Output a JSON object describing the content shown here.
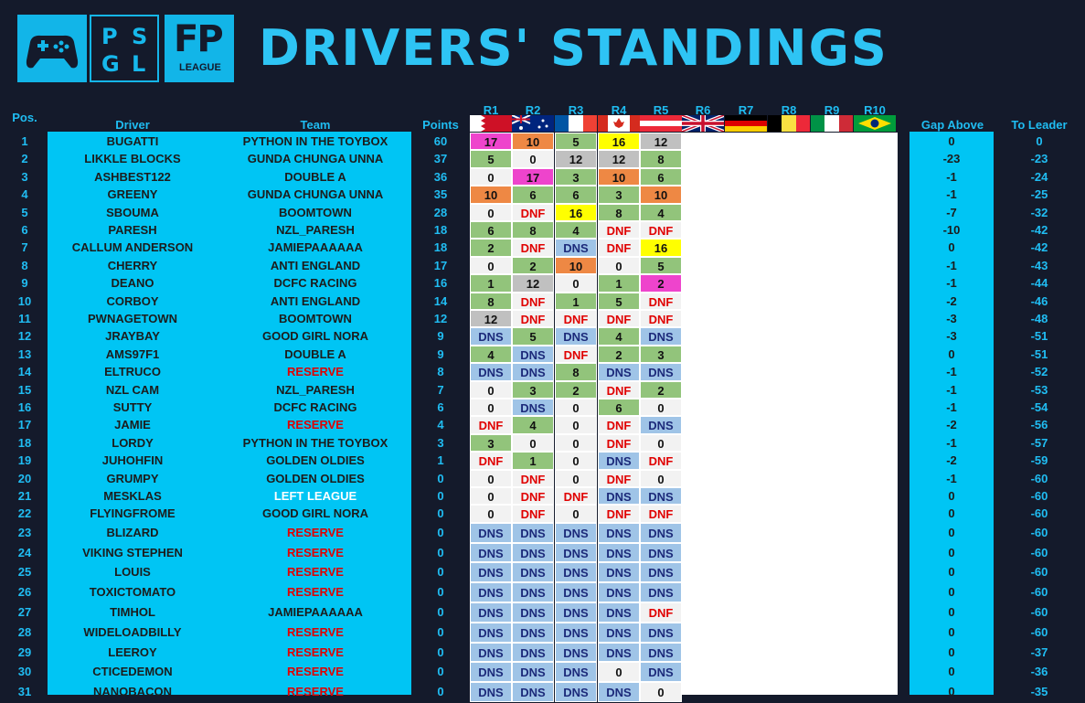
{
  "title": "DRIVERS' STANDINGS",
  "logos": {
    "psgl": [
      "P",
      "S",
      "G",
      "L"
    ],
    "fp": "FP",
    "fp_sub": "LEAGUE"
  },
  "headers": {
    "pos": "Pos.",
    "driver": "Driver",
    "team": "Team",
    "points": "Points",
    "gap": "Gap Above",
    "leader": "To Leader",
    "rounds": [
      "R1",
      "R2",
      "R3",
      "R4",
      "R5",
      "R6",
      "R7",
      "R8",
      "R9",
      "R10"
    ]
  },
  "flags": [
    "bahrain-flag",
    "australia-flag",
    "france-flag",
    "canada-flag",
    "austria-flag",
    "uk-flag",
    "germany-flag",
    "belgium-flag",
    "italy-flag",
    "brazil-flag"
  ],
  "colors": {
    "bg": "#141a2b",
    "accent": "#00c5f4",
    "pink": "#ee44cc",
    "orange": "#ee8844",
    "yellow": "#ffff00",
    "silver": "#c0c0c0",
    "green": "#92c47b",
    "dns": "#9fc4e7",
    "light": "#f2f2f2",
    "dnf_text": "#e00000",
    "dns_text": "#1c2a7a",
    "reserve_text": "#e00000",
    "left_text": "#ffffff"
  },
  "rows": [
    {
      "pos": "1",
      "driver": "BUGATTI",
      "team": "PYTHON IN THE TOYBOX",
      "team_style": "n",
      "points": "60",
      "r": [
        "17",
        "10",
        "5",
        "16",
        "12"
      ],
      "c": [
        "pink",
        "orange",
        "green",
        "yellow",
        "silver"
      ],
      "gap": "0",
      "leader": "0"
    },
    {
      "pos": "2",
      "driver": "LIKKLE BLOCKS",
      "team": "GUNDA CHUNGA UNNA",
      "team_style": "n",
      "points": "37",
      "r": [
        "5",
        "0",
        "12",
        "12",
        "8"
      ],
      "c": [
        "green",
        "light",
        "silver",
        "silver",
        "green"
      ],
      "gap": "-23",
      "leader": "-23"
    },
    {
      "pos": "3",
      "driver": "ASHBEST122",
      "team": "DOUBLE A",
      "team_style": "n",
      "points": "36",
      "r": [
        "0",
        "17",
        "3",
        "10",
        "6"
      ],
      "c": [
        "light",
        "pink",
        "green",
        "orange",
        "green"
      ],
      "gap": "-1",
      "leader": "-24"
    },
    {
      "pos": "4",
      "driver": "GREENY",
      "team": "GUNDA CHUNGA UNNA",
      "team_style": "n",
      "points": "35",
      "r": [
        "10",
        "6",
        "6",
        "3",
        "10"
      ],
      "c": [
        "orange",
        "green",
        "green",
        "green",
        "orange"
      ],
      "gap": "-1",
      "leader": "-25"
    },
    {
      "pos": "5",
      "driver": "SBOUMA",
      "team": "BOOMTOWN",
      "team_style": "n",
      "points": "28",
      "r": [
        "0",
        "DNF",
        "16",
        "8",
        "4"
      ],
      "c": [
        "light",
        "light",
        "yellow",
        "green",
        "green"
      ],
      "gap": "-7",
      "leader": "-32"
    },
    {
      "pos": "6",
      "driver": "PARESH",
      "team": "NZL_PARESH",
      "team_style": "n",
      "points": "18",
      "r": [
        "6",
        "8",
        "4",
        "DNF",
        "DNF"
      ],
      "c": [
        "green",
        "green",
        "green",
        "light",
        "light"
      ],
      "gap": "-10",
      "leader": "-42"
    },
    {
      "pos": "7",
      "driver": "CALLUM ANDERSON",
      "team": "JAMIEPAAAAAA",
      "team_style": "n",
      "points": "18",
      "r": [
        "2",
        "DNF",
        "DNS",
        "DNF",
        "16"
      ],
      "c": [
        "green",
        "light",
        "dns",
        "light",
        "yellow"
      ],
      "gap": "0",
      "leader": "-42"
    },
    {
      "pos": "8",
      "driver": "CHERRY",
      "team": "ANTI ENGLAND",
      "team_style": "n",
      "points": "17",
      "r": [
        "0",
        "2",
        "10",
        "0",
        "5"
      ],
      "c": [
        "light",
        "green",
        "orange",
        "light",
        "green"
      ],
      "gap": "-1",
      "leader": "-43"
    },
    {
      "pos": "9",
      "driver": "DEANO",
      "team": "DCFC RACING",
      "team_style": "n",
      "points": "16",
      "r": [
        "1",
        "12",
        "0",
        "1",
        "2"
      ],
      "c": [
        "green",
        "silver",
        "light",
        "green",
        "pink"
      ],
      "gap": "-1",
      "leader": "-44"
    },
    {
      "pos": "10",
      "driver": "CORBOY",
      "team": "ANTI ENGLAND",
      "team_style": "n",
      "points": "14",
      "r": [
        "8",
        "DNF",
        "1",
        "5",
        "DNF"
      ],
      "c": [
        "green",
        "light",
        "green",
        "green",
        "light"
      ],
      "gap": "-2",
      "leader": "-46"
    },
    {
      "pos": "11",
      "driver": "PWNAGETOWN",
      "team": "BOOMTOWN",
      "team_style": "n",
      "points": "12",
      "r": [
        "12",
        "DNF",
        "DNF",
        "DNF",
        "DNF"
      ],
      "c": [
        "silver",
        "light",
        "light",
        "light",
        "light"
      ],
      "gap": "-3",
      "leader": "-48"
    },
    {
      "pos": "12",
      "driver": "JRAYBAY",
      "team": "GOOD GIRL NORA",
      "team_style": "n",
      "points": "9",
      "r": [
        "DNS",
        "5",
        "DNS",
        "4",
        "DNS"
      ],
      "c": [
        "dns",
        "green",
        "dns",
        "green",
        "dns"
      ],
      "gap": "-3",
      "leader": "-51"
    },
    {
      "pos": "13",
      "driver": "AMS97F1",
      "team": "DOUBLE A",
      "team_style": "n",
      "points": "9",
      "r": [
        "4",
        "DNS",
        "DNF",
        "2",
        "3"
      ],
      "c": [
        "green",
        "dns",
        "light",
        "green",
        "green"
      ],
      "gap": "0",
      "leader": "-51"
    },
    {
      "pos": "14",
      "driver": "ELTRUCO",
      "team": "RESERVE",
      "team_style": "r",
      "points": "8",
      "r": [
        "DNS",
        "DNS",
        "8",
        "DNS",
        "DNS"
      ],
      "c": [
        "dns",
        "dns",
        "green",
        "dns",
        "dns"
      ],
      "gap": "-1",
      "leader": "-52"
    },
    {
      "pos": "15",
      "driver": "NZL CAM",
      "team": "NZL_PARESH",
      "team_style": "n",
      "points": "7",
      "r": [
        "0",
        "3",
        "2",
        "DNF",
        "2"
      ],
      "c": [
        "light",
        "green",
        "green",
        "light",
        "green"
      ],
      "gap": "-1",
      "leader": "-53"
    },
    {
      "pos": "16",
      "driver": "SUTTY",
      "team": "DCFC RACING",
      "team_style": "n",
      "points": "6",
      "r": [
        "0",
        "DNS",
        "0",
        "6",
        "0"
      ],
      "c": [
        "light",
        "dns",
        "light",
        "green",
        "light"
      ],
      "gap": "-1",
      "leader": "-54"
    },
    {
      "pos": "17",
      "driver": "JAMIE",
      "team": "RESERVE",
      "team_style": "r",
      "points": "4",
      "r": [
        "DNF",
        "4",
        "0",
        "DNF",
        "DNS"
      ],
      "c": [
        "light",
        "green",
        "light",
        "light",
        "dns"
      ],
      "gap": "-2",
      "leader": "-56"
    },
    {
      "pos": "18",
      "driver": "LORDY",
      "team": "PYTHON IN THE TOYBOX",
      "team_style": "n",
      "points": "3",
      "r": [
        "3",
        "0",
        "0",
        "DNF",
        "0"
      ],
      "c": [
        "green",
        "light",
        "light",
        "light",
        "light"
      ],
      "gap": "-1",
      "leader": "-57"
    },
    {
      "pos": "19",
      "driver": "JUHOHFIN",
      "team": "GOLDEN OLDIES",
      "team_style": "n",
      "points": "1",
      "r": [
        "DNF",
        "1",
        "0",
        "DNS",
        "DNF"
      ],
      "c": [
        "light",
        "green",
        "light",
        "dns",
        "light"
      ],
      "gap": "-2",
      "leader": "-59"
    },
    {
      "pos": "20",
      "driver": "GRUMPY",
      "team": "GOLDEN OLDIES",
      "team_style": "n",
      "points": "0",
      "r": [
        "0",
        "DNF",
        "0",
        "DNF",
        "0"
      ],
      "c": [
        "light",
        "light",
        "light",
        "light",
        "light"
      ],
      "gap": "-1",
      "leader": "-60"
    },
    {
      "pos": "21",
      "driver": "MESKLAS",
      "team": "LEFT LEAGUE",
      "team_style": "w",
      "points": "0",
      "r": [
        "0",
        "DNF",
        "DNF",
        "DNS",
        "DNS"
      ],
      "c": [
        "light",
        "light",
        "light",
        "dns",
        "dns"
      ],
      "gap": "0",
      "leader": "-60"
    },
    {
      "pos": "22",
      "driver": "FLYINGFROME",
      "team": "GOOD GIRL NORA",
      "team_style": "n",
      "points": "0",
      "r": [
        "0",
        "DNF",
        "0",
        "DNF",
        "DNF"
      ],
      "c": [
        "light",
        "light",
        "light",
        "light",
        "light"
      ],
      "gap": "0",
      "leader": "-60"
    },
    {
      "pos": "23",
      "driver": "BLIZARD",
      "team": "RESERVE",
      "team_style": "r",
      "points": "0",
      "r": [
        "DNS",
        "DNS",
        "DNS",
        "DNS",
        "DNS"
      ],
      "c": [
        "dns",
        "dns",
        "dns",
        "dns",
        "dns"
      ],
      "gap": "0",
      "leader": "-60"
    },
    {
      "pos": "24",
      "driver": "VIKING STEPHEN",
      "team": "RESERVE",
      "team_style": "r",
      "points": "0",
      "r": [
        "DNS",
        "DNS",
        "DNS",
        "DNS",
        "DNS"
      ],
      "c": [
        "dns",
        "dns",
        "dns",
        "dns",
        "dns"
      ],
      "gap": "0",
      "leader": "-60"
    },
    {
      "pos": "25",
      "driver": "LOUIS",
      "team": "RESERVE",
      "team_style": "r",
      "points": "0",
      "r": [
        "DNS",
        "DNS",
        "DNS",
        "DNS",
        "DNS"
      ],
      "c": [
        "dns",
        "dns",
        "dns",
        "dns",
        "dns"
      ],
      "gap": "0",
      "leader": "-60"
    },
    {
      "pos": "26",
      "driver": "TOXICTOMATO",
      "team": "RESERVE",
      "team_style": "r",
      "points": "0",
      "r": [
        "DNS",
        "DNS",
        "DNS",
        "DNS",
        "DNS"
      ],
      "c": [
        "dns",
        "dns",
        "dns",
        "dns",
        "dns"
      ],
      "gap": "0",
      "leader": "-60"
    },
    {
      "pos": "27",
      "driver": "TIMHOL",
      "team": "JAMIEPAAAAAA",
      "team_style": "n",
      "points": "0",
      "r": [
        "DNS",
        "DNS",
        "DNS",
        "DNS",
        "DNF"
      ],
      "c": [
        "dns",
        "dns",
        "dns",
        "dns",
        "light"
      ],
      "gap": "0",
      "leader": "-60"
    },
    {
      "pos": "28",
      "driver": "WIDELOADBILLY",
      "team": "RESERVE",
      "team_style": "r",
      "points": "0",
      "r": [
        "DNS",
        "DNS",
        "DNS",
        "DNS",
        "DNS"
      ],
      "c": [
        "dns",
        "dns",
        "dns",
        "dns",
        "dns"
      ],
      "gap": "0",
      "leader": "-60"
    },
    {
      "pos": "29",
      "driver": "LEEROY",
      "team": "RESERVE",
      "team_style": "r",
      "points": "0",
      "r": [
        "DNS",
        "DNS",
        "DNS",
        "DNS",
        "DNS"
      ],
      "c": [
        "dns",
        "dns",
        "dns",
        "dns",
        "dns"
      ],
      "gap": "0",
      "leader": "-37"
    },
    {
      "pos": "30",
      "driver": "CTICEDEMON",
      "team": "RESERVE",
      "team_style": "r",
      "points": "0",
      "r": [
        "DNS",
        "DNS",
        "DNS",
        "0",
        "DNS"
      ],
      "c": [
        "dns",
        "dns",
        "dns",
        "light",
        "dns"
      ],
      "gap": "0",
      "leader": "-36"
    },
    {
      "pos": "31",
      "driver": "NANOBACON",
      "team": "RESERVE",
      "team_style": "r",
      "points": "0",
      "r": [
        "DNS",
        "DNS",
        "DNS",
        "DNS",
        "0"
      ],
      "c": [
        "dns",
        "dns",
        "dns",
        "dns",
        "light"
      ],
      "gap": "0",
      "leader": "-35"
    }
  ]
}
